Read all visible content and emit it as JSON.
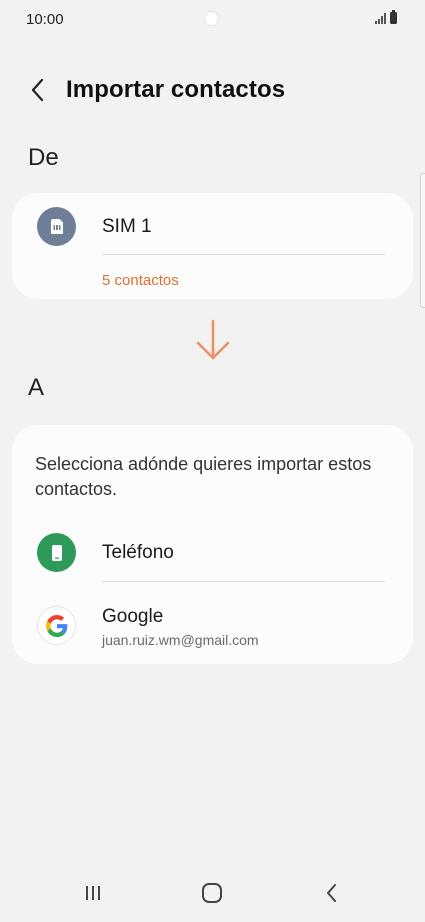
{
  "status_bar": {
    "time": "10:00"
  },
  "header": {
    "title": "Importar contactos"
  },
  "from_section": {
    "label": "De",
    "source": {
      "name": "SIM 1",
      "count": "5 contactos"
    }
  },
  "to_section": {
    "label": "A",
    "prompt": "Selecciona adónde quieres importar estos contactos.",
    "options": [
      {
        "title": "Teléfono"
      },
      {
        "title": "Google",
        "subtitle": "juan.ruiz.wm@gmail.com"
      }
    ]
  },
  "colors": {
    "accent_orange": "#e06f2b",
    "sim_icon": "#6e7f97",
    "phone_icon": "#2e9a5a",
    "background": "#f2f2f2",
    "card": "#fcfcfc"
  }
}
